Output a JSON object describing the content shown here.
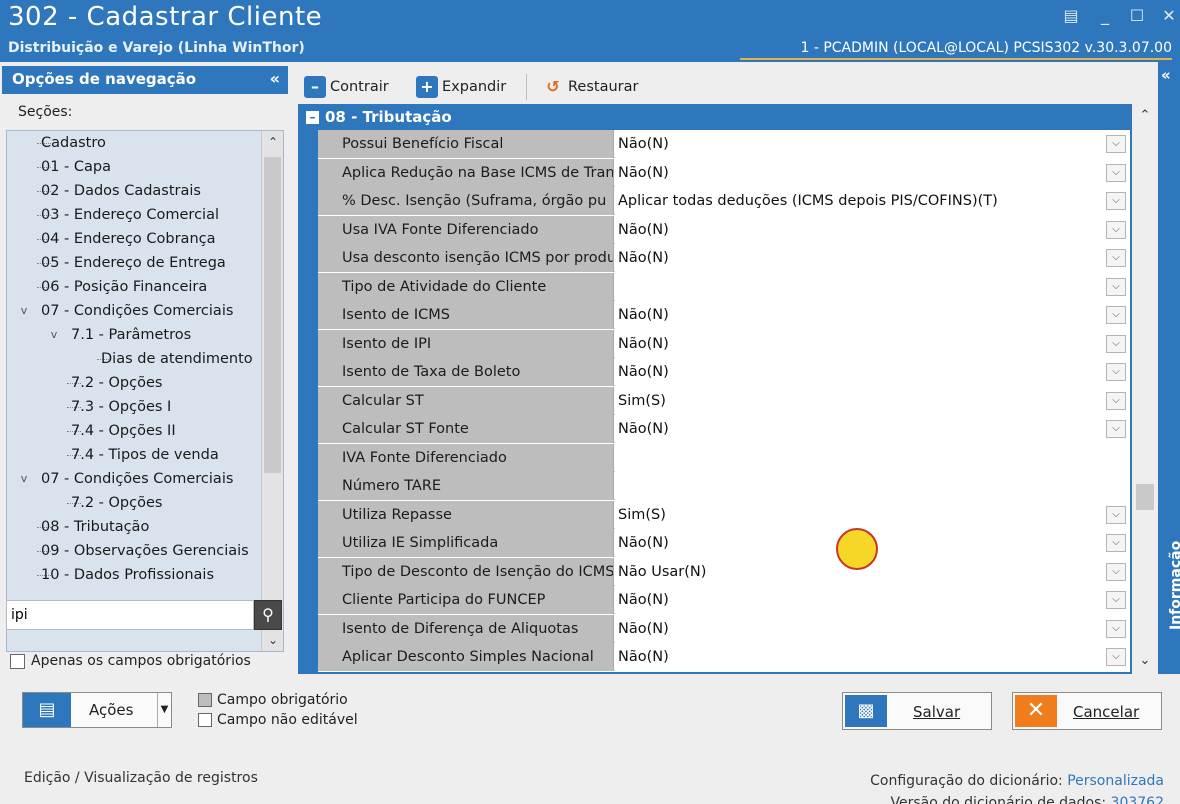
{
  "window": {
    "title": "302 - Cadastrar Cliente",
    "subtitle": "Distribuição e Varejo (Linha WinThor)",
    "session": "1 - PCADMIN (LOCAL@LOCAL)   PCSIS302  v.30.3.07.00"
  },
  "nav": {
    "header": "Opções de navegação",
    "collapse": "«",
    "sections_label": "Seções:",
    "items": [
      {
        "label": "Cadastro",
        "indent": 0,
        "expander": ""
      },
      {
        "label": "01 - Capa",
        "indent": 0,
        "expander": ""
      },
      {
        "label": "02 - Dados Cadastrais",
        "indent": 0,
        "expander": ""
      },
      {
        "label": "03 - Endereço Comercial",
        "indent": 0,
        "expander": ""
      },
      {
        "label": "04 - Endereço Cobrança",
        "indent": 0,
        "expander": ""
      },
      {
        "label": "05 - Endereço de Entrega",
        "indent": 0,
        "expander": ""
      },
      {
        "label": "06 - Posição Financeira",
        "indent": 0,
        "expander": ""
      },
      {
        "label": "07 - Condições Comerciais",
        "indent": 0,
        "expander": "v"
      },
      {
        "label": "7.1 - Parâmetros",
        "indent": 1,
        "expander": "v"
      },
      {
        "label": "Dias de atendimento",
        "indent": 2,
        "expander": ""
      },
      {
        "label": "7.2 - Opções",
        "indent": 1,
        "expander": ""
      },
      {
        "label": "7.3 - Opções I",
        "indent": 1,
        "expander": ""
      },
      {
        "label": "7.4 - Opções II",
        "indent": 1,
        "expander": ""
      },
      {
        "label": "7.4 - Tipos de venda",
        "indent": 1,
        "expander": ""
      },
      {
        "label": "07 - Condições Comerciais",
        "indent": 0,
        "expander": "v"
      },
      {
        "label": "7.2 - Opções",
        "indent": 1,
        "expander": ""
      },
      {
        "label": "08 - Tributação",
        "indent": 0,
        "expander": ""
      },
      {
        "label": "09 - Observações Gerenciais",
        "indent": 0,
        "expander": ""
      },
      {
        "label": "10 - Dados Profissionais",
        "indent": 0,
        "expander": ""
      }
    ],
    "search_value": "ipi",
    "only_required_label": "Apenas os campos obrigatórios"
  },
  "toolbar": {
    "collapse_label": "Contrair",
    "expand_label": "Expandir",
    "restore_label": "Restaurar"
  },
  "grid": {
    "section_title": "08 - Tributação",
    "rows": [
      {
        "label": "Possui Benefício Fiscal",
        "value": "Não(N)",
        "dropdown": true
      },
      {
        "label": "Aplica Redução na Base ICMS de Tran",
        "value": "Não(N)",
        "dropdown": true
      },
      {
        "label": "% Desc. Isenção (Suframa, órgão pu",
        "value": "Aplicar todas deduções (ICMS depois PIS/COFINS)(T)",
        "dropdown": true
      },
      {
        "label": "Usa IVA Fonte Diferenciado",
        "value": "Não(N)",
        "dropdown": true
      },
      {
        "label": "Usa desconto isenção ICMS por produ",
        "value": "Não(N)",
        "dropdown": true
      },
      {
        "label": "Tipo de Atividade do Cliente",
        "value": "",
        "dropdown": true
      },
      {
        "label": "Isento de ICMS",
        "value": "Não(N)",
        "dropdown": true
      },
      {
        "label": "Isento de IPI",
        "value": "Não(N)",
        "dropdown": true
      },
      {
        "label": "Isento de Taxa de Boleto",
        "value": "Não(N)",
        "dropdown": true
      },
      {
        "label": "Calcular ST",
        "value": "Sim(S)",
        "dropdown": true
      },
      {
        "label": "Calcular ST Fonte",
        "value": "Não(N)",
        "dropdown": true
      },
      {
        "label": "IVA Fonte Diferenciado",
        "value": "",
        "dropdown": false
      },
      {
        "label": "Número TARE",
        "value": "",
        "dropdown": false
      },
      {
        "label": "Utiliza Repasse",
        "value": "Sim(S)",
        "dropdown": true
      },
      {
        "label": "Utiliza IE Simplificada",
        "value": "Não(N)",
        "dropdown": true
      },
      {
        "label": "Tipo de Desconto de Isenção do ICMS",
        "value": "Não Usar(N)",
        "dropdown": true
      },
      {
        "label": "Cliente Participa do FUNCEP",
        "value": "Não(N)",
        "dropdown": true
      },
      {
        "label": "Isento de Diferença de Aliquotas",
        "value": "Não(N)",
        "dropdown": true
      },
      {
        "label": "Aplicar Desconto Simples Nacional",
        "value": "Não(N)",
        "dropdown": true
      }
    ]
  },
  "info_panel": {
    "label": "Informação",
    "arrow": "«"
  },
  "footer": {
    "actions_label": "Ações",
    "legend_required": "Campo obrigatório",
    "legend_readonly": "Campo não editável",
    "save_label": "Salvar",
    "cancel_label": "Cancelar",
    "status_left": "Edição / Visualização de registros",
    "dict_config_label": "Configuração do dicionário:",
    "dict_config_value": "Personalizada",
    "dict_version_label": "Versão do dicionário de dados:",
    "dict_version_value": "303762"
  },
  "colors": {
    "accent": "#2f77bd",
    "cancel": "#f07c1c",
    "label_cell": "#bdbdbd"
  }
}
